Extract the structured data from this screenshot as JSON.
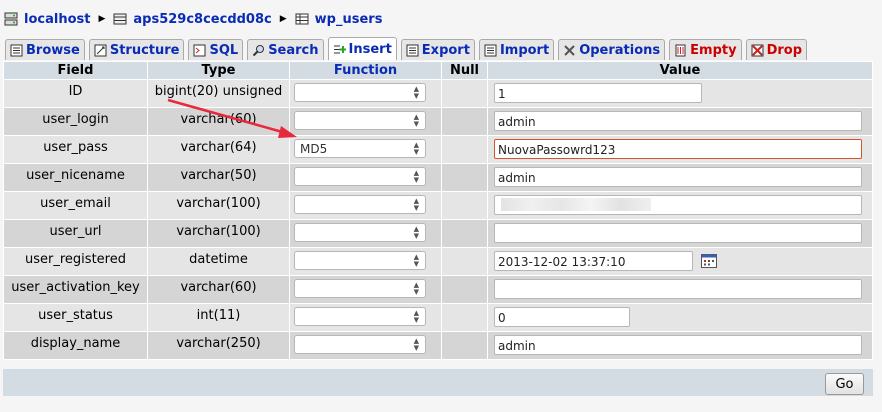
{
  "breadcrumb": {
    "server": "localhost",
    "database": "aps529c8cecdd08c",
    "table": "wp_users"
  },
  "tabs": [
    {
      "label": "Browse",
      "icon": "browse-icon"
    },
    {
      "label": "Structure",
      "icon": "structure-icon"
    },
    {
      "label": "SQL",
      "icon": "sql-icon"
    },
    {
      "label": "Search",
      "icon": "search-icon"
    },
    {
      "label": "Insert",
      "icon": "insert-icon"
    },
    {
      "label": "Export",
      "icon": "export-icon"
    },
    {
      "label": "Import",
      "icon": "import-icon"
    },
    {
      "label": "Operations",
      "icon": "operations-icon"
    },
    {
      "label": "Empty",
      "icon": "empty-icon"
    },
    {
      "label": "Drop",
      "icon": "drop-icon"
    }
  ],
  "active_tab": "Insert",
  "headers": {
    "field": "Field",
    "type": "Type",
    "function": "Function",
    "null": "Null",
    "value": "Value"
  },
  "rows": [
    {
      "field": "ID",
      "type": "bigint(20) unsigned",
      "function": "",
      "value": "1"
    },
    {
      "field": "user_login",
      "type": "varchar(60)",
      "function": "",
      "value": "admin"
    },
    {
      "field": "user_pass",
      "type": "varchar(64)",
      "function": "MD5",
      "value": "NuovaPassowrd123"
    },
    {
      "field": "user_nicename",
      "type": "varchar(50)",
      "function": "",
      "value": "admin"
    },
    {
      "field": "user_email",
      "type": "varchar(100)",
      "function": "",
      "value": ""
    },
    {
      "field": "user_url",
      "type": "varchar(100)",
      "function": "",
      "value": ""
    },
    {
      "field": "user_registered",
      "type": "datetime",
      "function": "",
      "value": "2013-12-02 13:37:10"
    },
    {
      "field": "user_activation_key",
      "type": "varchar(60)",
      "function": "",
      "value": ""
    },
    {
      "field": "user_status",
      "type": "int(11)",
      "function": "",
      "value": "0"
    },
    {
      "field": "display_name",
      "type": "varchar(250)",
      "function": "",
      "value": "admin"
    }
  ],
  "go_button": "Go",
  "colors": {
    "link": "#0a2bb5",
    "danger": "#cc0000",
    "header_bg": "#d3dce3",
    "annotation_arrow": "#e8283c"
  }
}
